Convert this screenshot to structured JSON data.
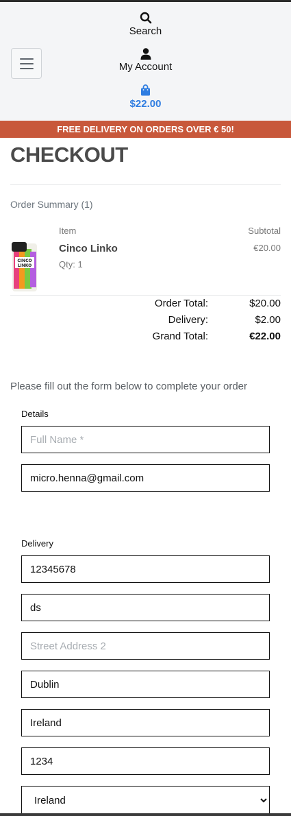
{
  "header": {
    "search_label": "Search",
    "account_label": "My Account",
    "bag_total": "$22.00",
    "accent_color": "#2f7de1"
  },
  "banner": {
    "text": "FREE DELIVERY ON ORDERS OVER € 50!",
    "color": "#c8583b"
  },
  "page": {
    "title": "CHECKOUT"
  },
  "summary": {
    "heading": "Order Summary (1)",
    "col_item": "Item",
    "col_subtotal": "Subtotal",
    "items": [
      {
        "name": "Cinco Linko",
        "qty": "Qty: 1",
        "subtotal": "€20.00",
        "image_text": "CINCO LINKO"
      }
    ],
    "order_total_label": "Order Total:",
    "order_total": "$20.00",
    "delivery_label": "Delivery:",
    "delivery": "$2.00",
    "grand_total_label": "Grand Total:",
    "grand_total": "€22.00"
  },
  "form": {
    "intro": "Please fill out the form below to complete your order",
    "details_label": "Details",
    "full_name_placeholder": "Full Name *",
    "email_value": "micro.henna@gmail.com",
    "delivery_label": "Delivery",
    "phone_value": "12345678",
    "street1_value": "ds",
    "street2_placeholder": "Street Address 2",
    "town_value": "Dublin",
    "county_value": "Ireland",
    "postcode_value": "1234",
    "country_selected": "Ireland"
  }
}
